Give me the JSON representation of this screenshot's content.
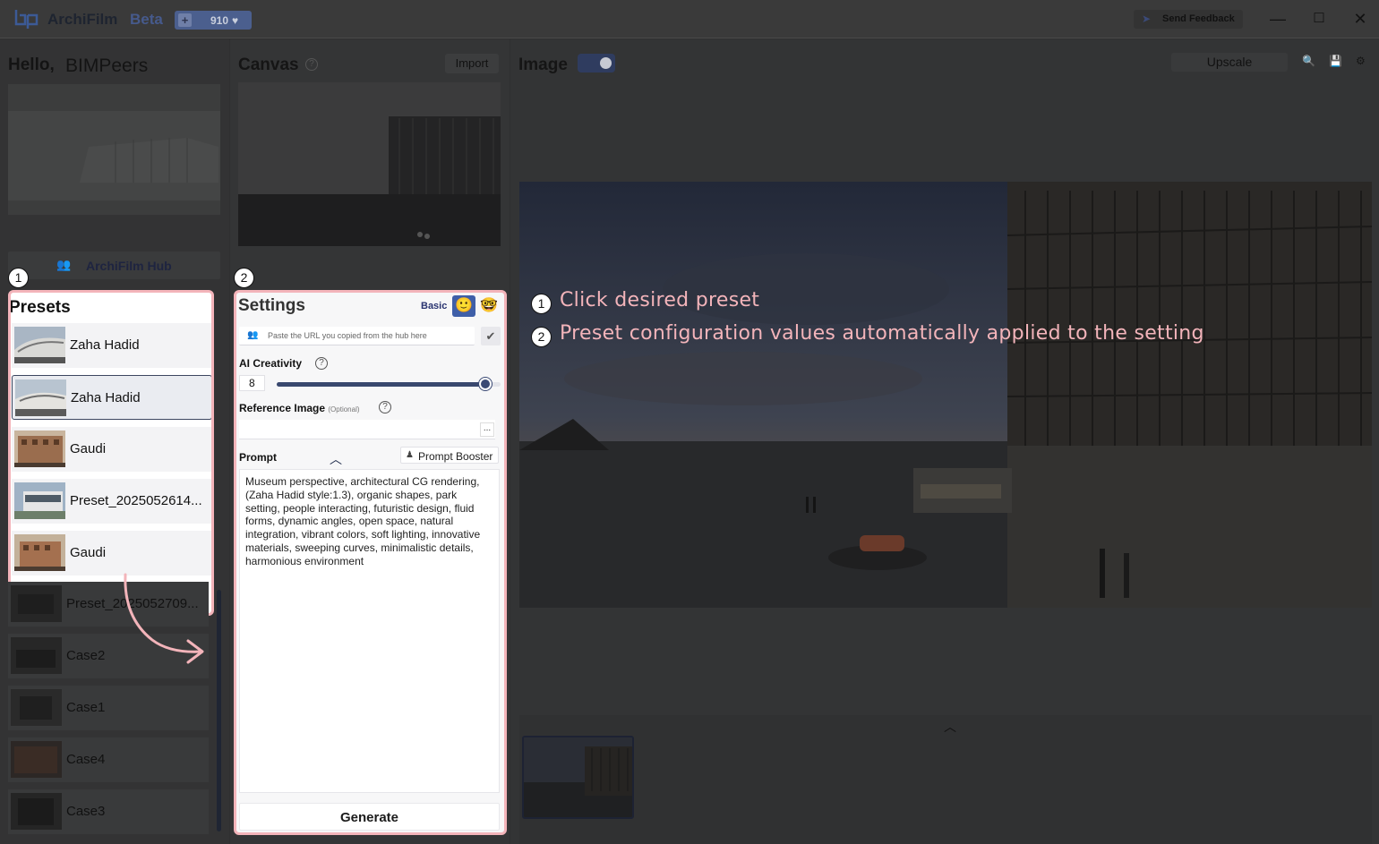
{
  "titlebar": {
    "app_name": "ArchiFilm",
    "app_badge": "Beta",
    "credits": "910",
    "feedback_label": "Send Feedback"
  },
  "sidebar": {
    "greeting": "Hello,",
    "username": "BIMPeers",
    "hub_label": "ArchiFilm Hub",
    "presets_title": "Presets",
    "presets": [
      {
        "name": "Zaha Hadid",
        "selected": false
      },
      {
        "name": "Zaha Hadid",
        "selected": true
      },
      {
        "name": "Gaudi",
        "selected": false
      },
      {
        "name": "Preset_2025052614...",
        "selected": false
      },
      {
        "name": "Gaudi",
        "selected": false
      },
      {
        "name": "Preset_2025052709...",
        "selected": false
      },
      {
        "name": "Case2",
        "selected": false
      },
      {
        "name": "Case1",
        "selected": false
      },
      {
        "name": "Case4",
        "selected": false
      },
      {
        "name": "Case3",
        "selected": false
      }
    ]
  },
  "canvas": {
    "title": "Canvas",
    "help": "?",
    "import_label": "Import"
  },
  "settings": {
    "title": "Settings",
    "mode_label": "Basic",
    "url_placeholder": "Paste the URL you copied from the hub here",
    "ai_creativity_label": "AI Creativity",
    "ai_creativity_value": "8",
    "ai_creativity_fraction": 0.93,
    "reference_label": "Reference Image",
    "reference_optional": "(Optional)",
    "reference_button": "...",
    "prompt_label": "Prompt",
    "prompt_booster_label": "Prompt Booster",
    "prompt_text": "Museum perspective, architectural CG rendering, (Zaha Hadid style:1.3), organic shapes, park setting, people interacting, futuristic design, fluid forms, dynamic angles, open space, natural integration, vibrant colors, soft lighting, innovative materials, sweeping curves, minimalistic details, harmonious environment",
    "generate_label": "Generate"
  },
  "image_panel": {
    "title": "Image",
    "toggle_on": true,
    "upscale_label": "Upscale"
  },
  "annotations": {
    "badge_1": "1",
    "badge_2": "2",
    "step_1": "Click desired preset",
    "step_2": "Preset configuration values automatically applied to the setting"
  },
  "colors": {
    "accent": "#3b4a74",
    "annotation": "#f3b4ba",
    "overlay": "#333435"
  }
}
